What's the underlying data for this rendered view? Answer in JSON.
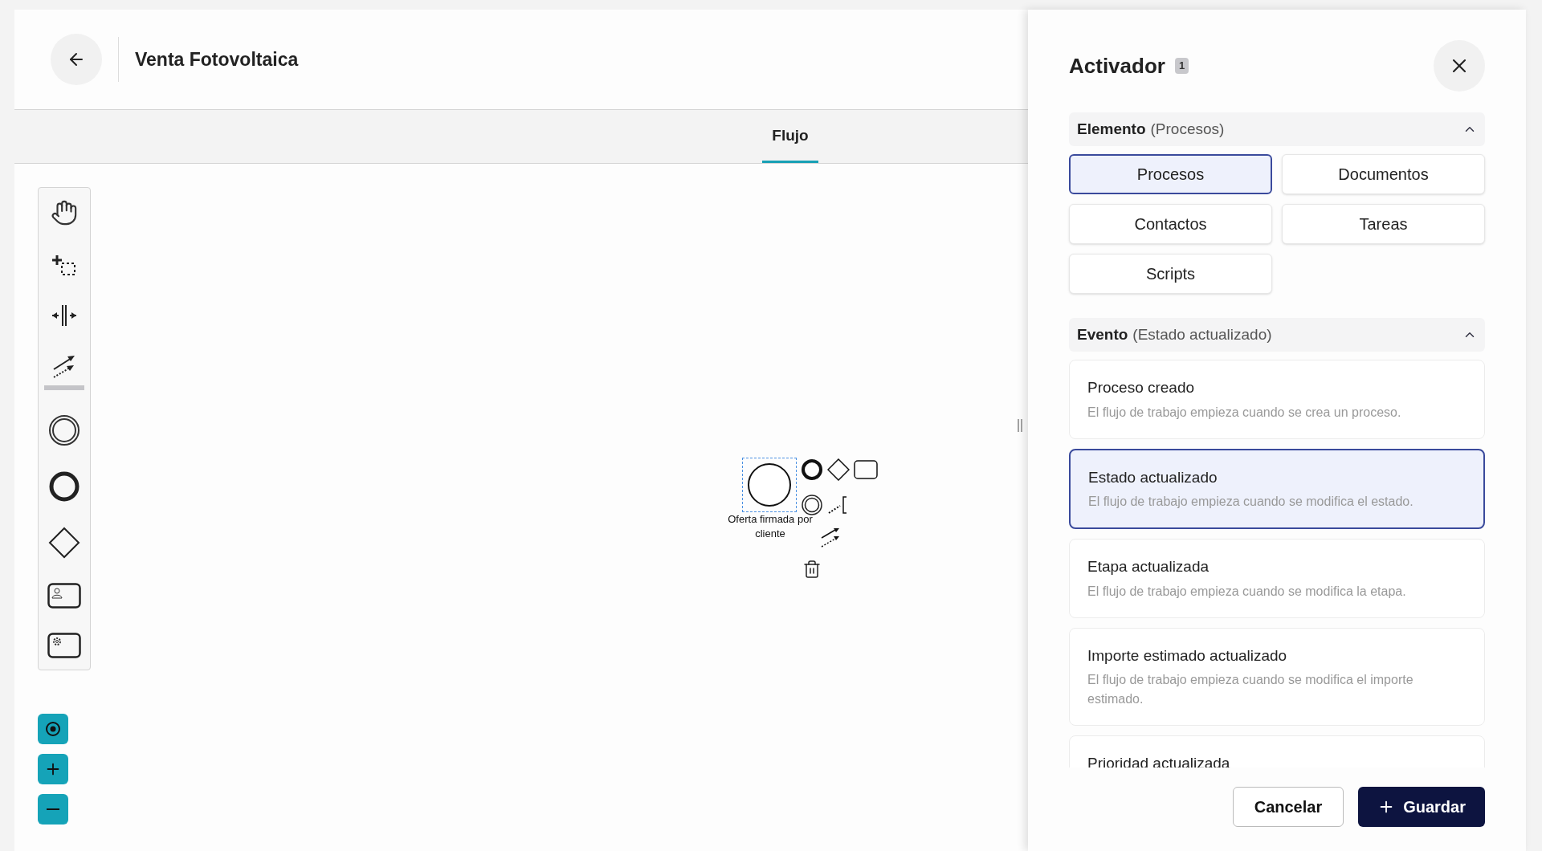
{
  "header": {
    "title": "Venta Fotovoltaica"
  },
  "tabs": [
    {
      "label": "Flujo",
      "selected": true
    }
  ],
  "canvas": {
    "node_label": "Oferta firmada por cliente"
  },
  "panel": {
    "title": "Activador",
    "badge": "1",
    "element_section": {
      "label": "Elemento",
      "value": "(Procesos)",
      "expanded": true,
      "options": [
        {
          "label": "Procesos",
          "selected": true
        },
        {
          "label": "Documentos",
          "selected": false
        },
        {
          "label": "Contactos",
          "selected": false
        },
        {
          "label": "Tareas",
          "selected": false
        },
        {
          "label": "Scripts",
          "selected": false
        }
      ]
    },
    "event_section": {
      "label": "Evento",
      "value": "(Estado actualizado)",
      "expanded": true,
      "options": [
        {
          "title": "Proceso creado",
          "description": "El flujo de trabajo empieza cuando se crea un proceso.",
          "selected": false
        },
        {
          "title": "Estado actualizado",
          "description": "El flujo de trabajo empieza cuando se modifica el estado.",
          "selected": true
        },
        {
          "title": "Etapa actualizada",
          "description": "El flujo de trabajo empieza cuando se modifica la etapa.",
          "selected": false
        },
        {
          "title": "Importe estimado actualizado",
          "description": "El flujo de trabajo empieza cuando se modifica el importe estimado.",
          "selected": false
        },
        {
          "title": "Prioridad actualizada",
          "selected": false
        }
      ]
    },
    "buttons": {
      "cancel": "Cancelar",
      "save": "Guardar"
    }
  }
}
